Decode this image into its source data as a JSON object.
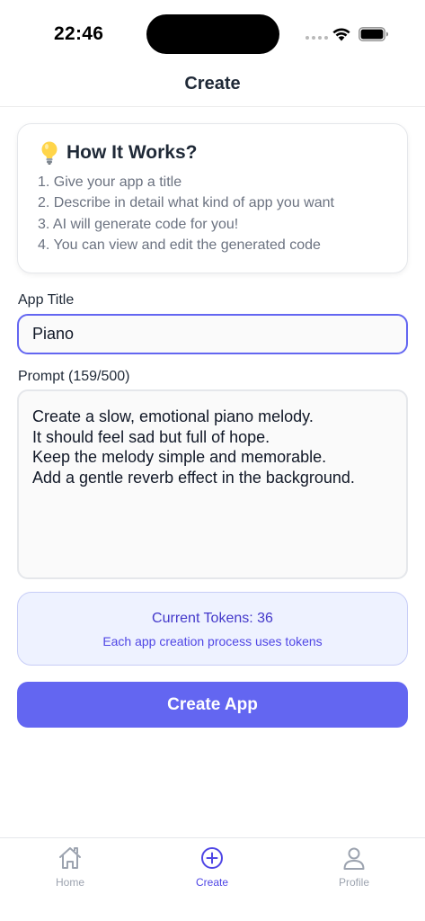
{
  "status_bar": {
    "time": "22:46"
  },
  "header": {
    "title": "Create"
  },
  "info": {
    "title": "How It Works?",
    "steps": [
      "1. Give your app a title",
      "2. Describe in detail what kind of app you want",
      "3. AI will generate code for you!",
      "4. You can view and edit the generated code"
    ]
  },
  "form": {
    "title_label": "App Title",
    "title_value": "Piano",
    "prompt_label": "Prompt (159/500)",
    "prompt_value": "Create a slow, emotional piano melody.\nIt should feel sad but full of hope.\nKeep the melody simple and memorable.\nAdd a gentle reverb effect in the background."
  },
  "tokens": {
    "line": "Current Tokens: 36",
    "note": "Each app creation process uses tokens"
  },
  "actions": {
    "create_label": "Create App"
  },
  "tabs": [
    {
      "label": "Home",
      "icon": "home-icon"
    },
    {
      "label": "Create",
      "icon": "plus-circle-icon",
      "active": true
    },
    {
      "label": "Profile",
      "icon": "person-icon"
    }
  ],
  "colors": {
    "accent": "#6366f1",
    "accent_dark": "#4f46e5",
    "tokens_bg": "#eef2ff"
  }
}
